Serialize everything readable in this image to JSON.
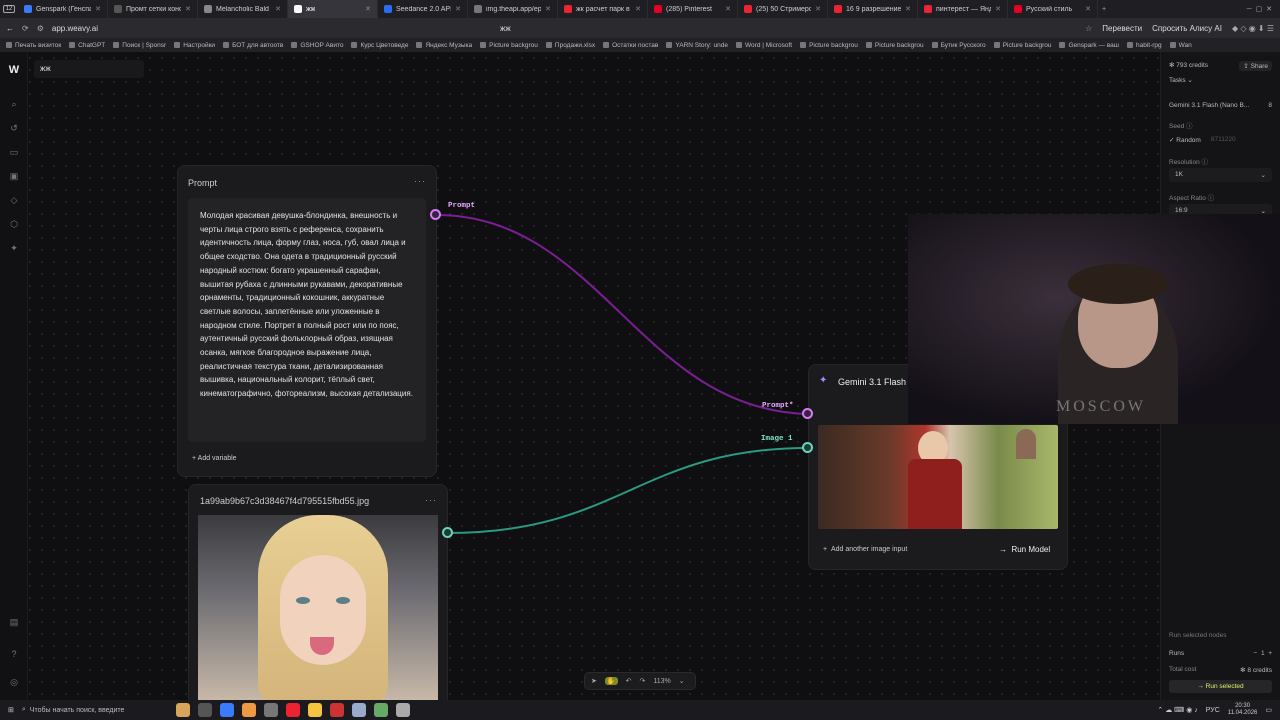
{
  "browser": {
    "tab_count": "12",
    "tabs": [
      {
        "label": "Genspark (Генспарк)",
        "color": "#3a7afe"
      },
      {
        "label": "Промт сетки консист",
        "color": "#555"
      },
      {
        "label": "Melancholic Bald Corp",
        "color": "#888"
      },
      {
        "label": "жж",
        "color": "#ffffff",
        "active": true
      },
      {
        "label": "Seedance 2.0 API - De",
        "color": "#2a6df5"
      },
      {
        "label": "img.theapi.app/epher",
        "color": "#777"
      },
      {
        "label": "жк расчет парк в ка",
        "color": "#e23"
      },
      {
        "label": "(285) Pinterest",
        "color": "#e60023"
      },
      {
        "label": "(25) 50 Стримеров Бо",
        "color": "#e23"
      },
      {
        "label": "16 9 разрешение — Я",
        "color": "#e23"
      },
      {
        "label": "пинтерест — Яндекс",
        "color": "#e23"
      },
      {
        "label": "Русский стиль",
        "color": "#e60023"
      }
    ],
    "url": "app.weavy.ai",
    "page_title": "жж",
    "translate": "Перевести",
    "ask_alice": "Спросить Алису AI",
    "bookmarks": [
      "Печать визиток",
      "ChatGPT",
      "Поиск | Sponsr",
      "Настройки",
      "БОТ для автоотв",
      "GSHOP Авито",
      "Курс Цветоведе",
      "Яндекс Музыка",
      "Picture backgrou",
      "Продажи.xlsx",
      "Остатки постав",
      "YARN Story: unde",
      "Word | Microsoft",
      "Picture backgrou",
      "Picture backgrou",
      "Бутик Русского",
      "Picture backgrou",
      "Genspark — ваш",
      "habit-rpg",
      "Wan"
    ]
  },
  "app": {
    "project_name": "жж",
    "prompt_node": {
      "title": "Prompt",
      "text": "Молодая красивая девушка-блондинка, внешность и черты лица строго взять с референса, сохранить идентичность лица, форму глаз, носа, губ, овал лица и общее сходство. Она одета в традиционный русский народный костюм: богато украшенный сарафан, вышитая рубаха с длинными рукавами, декоративные орнаменты, традиционный кокошник, аккуратные светлые волосы, заплетённые или уложенные в народном стиле. Портрет в полный рост или по пояс, аутентичный русский фольклорный образ, изящная осанка, мягкое благородное выражение лица, реалистичная текстура ткани, детализированная вышивка, национальный колорит, тёплый свет, кинематографично, фотореализм, высокая детализация.",
      "add_variable": "Add variable",
      "output_label": "Prompt"
    },
    "image_node": {
      "title": "1a99ab9b67c3d38467f4d795515fbd55.jpg"
    },
    "model_node": {
      "title": "Gemini 3.1 Flash (",
      "input_prompt": "Prompt*",
      "input_image": "Image 1",
      "add_image": "Add another image input",
      "run": "Run Model"
    },
    "canvas_tools": {
      "zoom": "113%"
    },
    "right_panel": {
      "credits": "793 credits",
      "share": "Share",
      "tasks": "Tasks",
      "model": "Gemini 3.1 Flash (Nano B...",
      "model_count": "8",
      "seed_label": "Seed",
      "seed_value": "Random",
      "seed_number": "8711220",
      "resolution_label": "Resolution",
      "resolution_value": "1K",
      "aspect_label": "Aspect Ratio",
      "aspect_value": "16:9",
      "run_selected_nodes": "Run selected nodes",
      "runs_label": "Runs",
      "runs_value": "1",
      "total_cost_label": "Total cost",
      "total_cost_value": "8 credits",
      "run_selected": "Run selected"
    },
    "webcam_text": "MOSCOW"
  },
  "taskbar": {
    "search_placeholder": "Чтобы начать поиск, введите",
    "lang": "РУС",
    "time": "20:30",
    "date": "11.04.2026"
  },
  "colors": {
    "prompt_wire": "#b02fd0",
    "image_wire": "#2fa58c",
    "accent": "#f3c1ff"
  }
}
